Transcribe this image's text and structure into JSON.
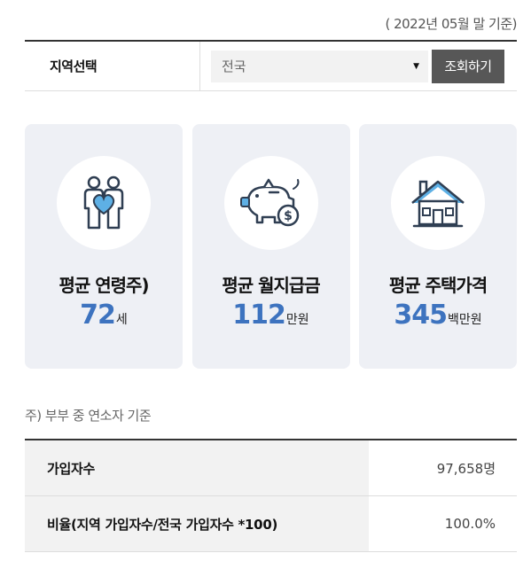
{
  "basis_date": "( 2022년 05월 말 기준)",
  "region": {
    "label": "지역선택",
    "selected": "전국",
    "search_label": "조회하기"
  },
  "cards": [
    {
      "icon": "couple-heart-icon",
      "title": "평균 연령주)",
      "value": "72",
      "unit": "세"
    },
    {
      "icon": "piggy-bank-icon",
      "title": "평균 월지급금",
      "value": "112",
      "unit": "만원"
    },
    {
      "icon": "house-icon",
      "title": "평균 주택가격",
      "value": "345",
      "unit": "백만원"
    }
  ],
  "footnote": "주) 부부 중 연소자 기준",
  "stats": [
    {
      "label": "가입자수",
      "value": "97,658명"
    },
    {
      "label": "비율(지역 가입자수/전국 가입자수 *100)",
      "value": "100.0%"
    }
  ],
  "colors": {
    "accent_blue": "#3d73bf",
    "icon_dark": "#2f3e52",
    "icon_light_blue": "#5eb0e5",
    "card_bg": "#eef0f5",
    "button_bg": "#575757"
  }
}
